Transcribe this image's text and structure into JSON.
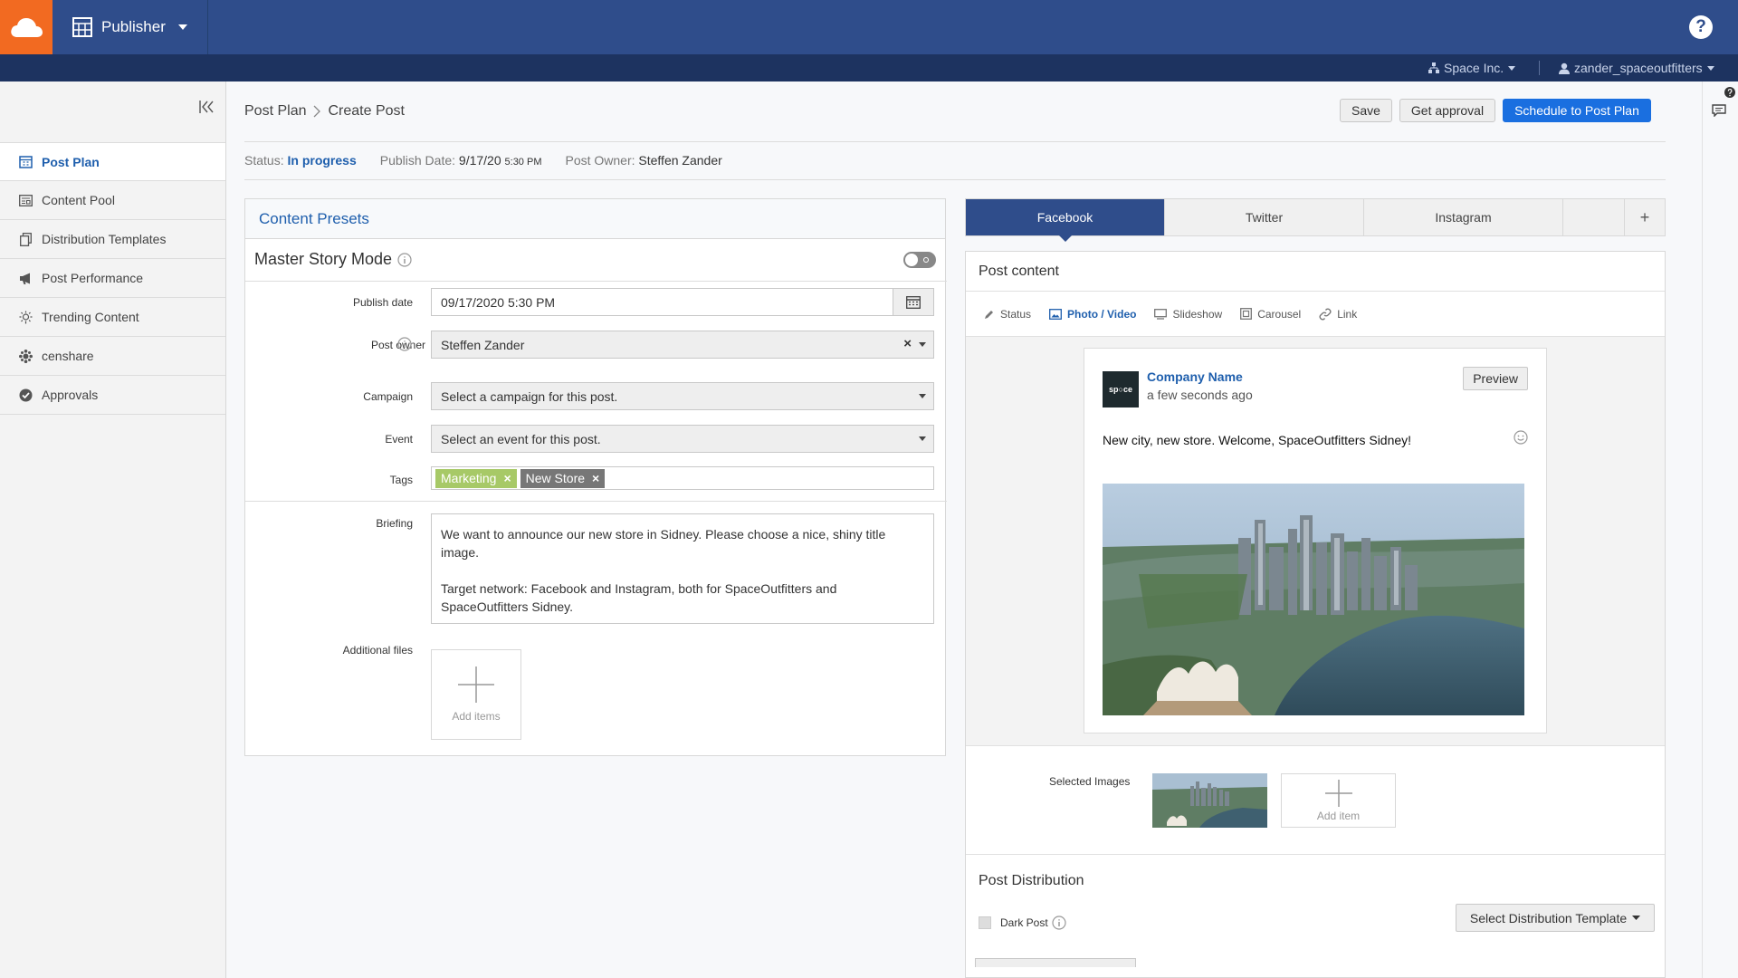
{
  "colors": {
    "header": "#2f4d8b",
    "subheader": "#1d3360",
    "accent": "#1a6fe0",
    "brand": "#f26a21",
    "tag_green": "#a7c967",
    "tag_grey": "#777777"
  },
  "topbar": {
    "app_name": "Publisher",
    "help_label": "?"
  },
  "subbar": {
    "org": "Space Inc.",
    "user": "zander_spaceoutfitters"
  },
  "sidebar": {
    "items": [
      {
        "label": "Post Plan",
        "icon": "calendar-icon",
        "active": true
      },
      {
        "label": "Content Pool",
        "icon": "content-pool-icon"
      },
      {
        "label": "Distribution Templates",
        "icon": "copy-icon"
      },
      {
        "label": "Post Performance",
        "icon": "megaphone-icon"
      },
      {
        "label": "Trending Content",
        "icon": "bulb-icon"
      },
      {
        "label": "censhare",
        "icon": "censhare-icon"
      },
      {
        "label": "Approvals",
        "icon": "check-circle-icon"
      }
    ]
  },
  "breadcrumb": {
    "root": "Post Plan",
    "current": "Create Post"
  },
  "actions": {
    "save": "Save",
    "approval": "Get approval",
    "schedule": "Schedule to Post Plan"
  },
  "status": {
    "status_label": "Status:",
    "status_value": "In progress",
    "publish_label": "Publish Date:",
    "publish_date": "9/17/20",
    "publish_time": "5:30 PM",
    "owner_label": "Post Owner:",
    "owner_value": "Steffen Zander"
  },
  "form": {
    "panel_title": "Content Presets",
    "master_story": "Master Story Mode",
    "publish_date_label": "Publish date",
    "publish_date_value": "09/17/2020 5:30 PM",
    "owner_label": "Post owner",
    "owner_value": "Steffen Zander",
    "campaign_label": "Campaign",
    "campaign_placeholder": "Select a campaign for this post.",
    "event_label": "Event",
    "event_placeholder": "Select an event for this post.",
    "tags_label": "Tags",
    "tags": [
      "Marketing",
      "New Store"
    ],
    "briefing_label": "Briefing",
    "briefing_text": "We want to announce our new store in Sidney. Please choose a nice, shiny title image.\n\nTarget network: Facebook and Instagram, both for SpaceOutfitters and SpaceOutfitters Sidney.",
    "files_label": "Additional files",
    "add_items": "Add items"
  },
  "tabs": [
    "Facebook",
    "Twitter",
    "Instagram"
  ],
  "tab_add": "+",
  "post": {
    "title": "Post content",
    "types": [
      "Status",
      "Photo / Video",
      "Slideshow",
      "Carousel",
      "Link"
    ],
    "company": "Company Name",
    "time": "a few seconds ago",
    "preview": "Preview",
    "text": "New city, new store. Welcome, SpaceOutfitters Sidney!",
    "avatar_text": "sp○ce",
    "selected_label": "Selected Images",
    "add_item": "Add item"
  },
  "distribution": {
    "title": "Post Distribution",
    "dark_post": "Dark Post",
    "template_select": "Select Distribution Template"
  }
}
